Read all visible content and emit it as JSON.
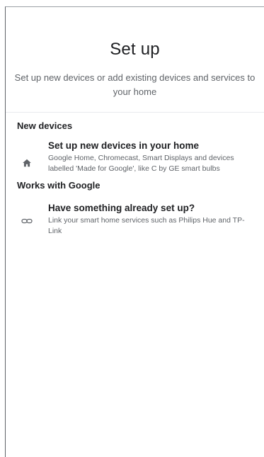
{
  "header": {
    "title": "Set up",
    "subtitle": "Set up new devices or add existing devices and services to your home"
  },
  "sections": {
    "new_devices": {
      "title": "New devices",
      "item": {
        "icon": "home-icon",
        "title": "Set up new devices in your home",
        "description": "Google Home, Chromecast, Smart Displays and devices labelled 'Made for Google', like C by GE smart bulbs"
      }
    },
    "works_with_google": {
      "title": "Works with Google",
      "item": {
        "icon": "link-icon",
        "title": "Have something already set up?",
        "description": "Link your smart home services such as Philips Hue and TP-Link"
      }
    }
  },
  "colors": {
    "text_primary": "#202124",
    "text_secondary": "#5f6368",
    "divider": "#e8eaed",
    "background": "#ffffff"
  }
}
